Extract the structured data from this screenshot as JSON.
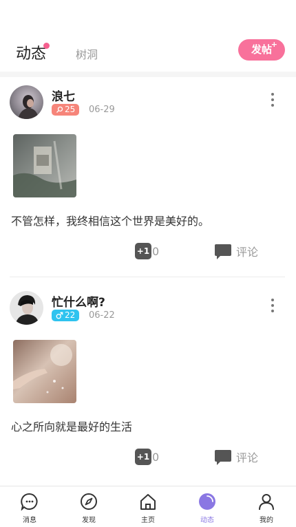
{
  "header": {
    "tab_active": "动态",
    "tab_inactive": "树洞",
    "post_button": "发帖",
    "post_button_plus": "+"
  },
  "posts": [
    {
      "username": "浪七",
      "age": "25",
      "gender": "female",
      "date": "06-29",
      "text": "不管怎样，我终相信这个世界是美好的。",
      "like_label": "+1",
      "like_count": "0",
      "comment_label": "评论"
    },
    {
      "username": "忙什么啊?",
      "age": "22",
      "gender": "male",
      "date": "06-22",
      "text": "心之所向就是最好的生活",
      "like_label": "+1",
      "like_count": "0",
      "comment_label": "评论"
    }
  ],
  "bottom_nav": [
    {
      "label": "消息",
      "icon": "message-icon",
      "active": false
    },
    {
      "label": "发现",
      "icon": "compass-icon",
      "active": false
    },
    {
      "label": "主页",
      "icon": "home-icon",
      "active": false
    },
    {
      "label": "动态",
      "icon": "feed-icon",
      "active": true
    },
    {
      "label": "我的",
      "icon": "user-icon",
      "active": false
    }
  ],
  "colors": {
    "accent_pink": "#f8719b",
    "accent_purple": "#8a77e3",
    "female_badge": "#f6857a",
    "male_badge": "#2fc3ef"
  }
}
